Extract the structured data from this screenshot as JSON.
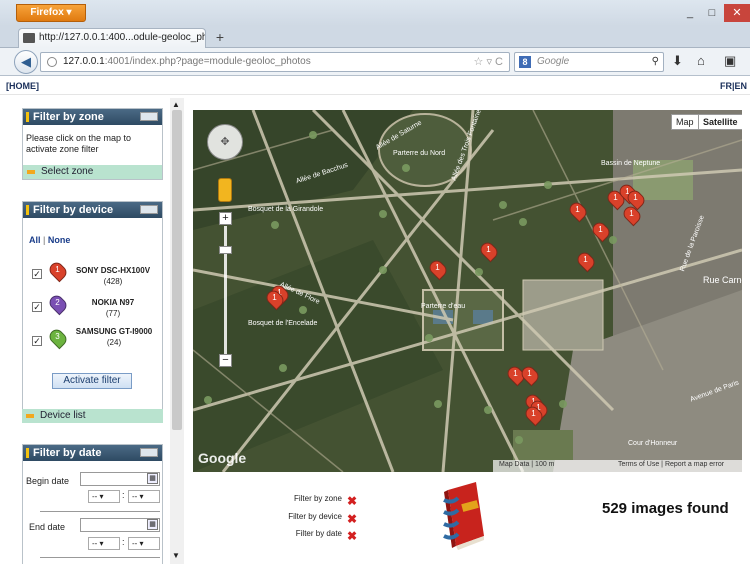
{
  "browser": {
    "menu_label": "Firefox ▾",
    "tab_title": "http://127.0.0.1:400...odule-geoloc_photos",
    "new_tab": "+",
    "url_host": "127.0.0.1",
    "url_rest": ":4001/index.php?page=module-geoloc_photos",
    "search_engine": "Google",
    "search_placeholder": "Google"
  },
  "page": {
    "home_link": "[HOME]",
    "lang_switch": "FR|EN"
  },
  "zone_panel": {
    "title": "Filter by zone",
    "instruction": "Please click on the map to activate zone filter",
    "footer": "Select zone"
  },
  "device_panel": {
    "title": "Filter by device",
    "all": "All",
    "separator": "|",
    "none": "None",
    "devices": [
      {
        "name": "SONY DSC-HX100V",
        "count": "(428)",
        "pin_color": "#d9412a",
        "pin_label": "1",
        "checked": true
      },
      {
        "name": "NOKIA N97",
        "count": "(77)",
        "pin_color": "#7a4fb3",
        "pin_label": "2",
        "checked": true
      },
      {
        "name": "SAMSUNG GT-I9000",
        "count": "(24)",
        "pin_color": "#6cb33f",
        "pin_label": "3",
        "checked": true
      }
    ],
    "activate_button": "Activate filter",
    "footer": "Device list"
  },
  "date_panel": {
    "title": "Filter by date",
    "begin_label": "Begin date",
    "end_label": "End date",
    "hour_default": "--",
    "minute_default": "--",
    "time_sep": ":"
  },
  "map": {
    "type_map": "Map",
    "type_satellite": "Satellite",
    "logo": "Google",
    "attribution": "Map Data  |  100 m",
    "terms": "Terms of Use  |  Report a map error",
    "zoom_in": "+",
    "zoom_out": "−",
    "labels": [
      "Bosquet de la Girandole",
      "Allée de Bacchus",
      "Allée de Saturne",
      "Allée des Trois Fontaines",
      "Parterre du Nord",
      "Bassin de Neptune",
      "Rue de la Paroisse",
      "Rue Carnot",
      "Avenue de Paris",
      "Allée de Flore",
      "Parterre d'eau",
      "Bosquet de l'Encelade",
      "Cour d'Honneur"
    ]
  },
  "summary": {
    "filter_zone": "Filter by zone",
    "filter_device": "Filter by device",
    "filter_date": "Filter by date",
    "x_mark": "✖",
    "count_text": "529 images found"
  }
}
